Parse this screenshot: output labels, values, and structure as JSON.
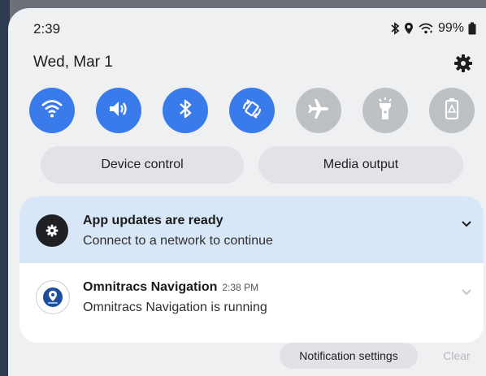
{
  "status_bar": {
    "time": "2:39",
    "battery": "99%",
    "icons": [
      "bluetooth-icon",
      "location-icon",
      "wifi-icon",
      "battery-icon"
    ]
  },
  "header": {
    "date": "Wed, Mar 1",
    "settings_icon": "gear-icon"
  },
  "quick_settings": [
    {
      "name": "wifi",
      "icon": "wifi-icon",
      "state": "on"
    },
    {
      "name": "sound",
      "icon": "volume-icon",
      "state": "on"
    },
    {
      "name": "bluetooth",
      "icon": "bluetooth-icon",
      "state": "on"
    },
    {
      "name": "auto-rotate",
      "icon": "rotate-icon",
      "state": "on"
    },
    {
      "name": "airplane-mode",
      "icon": "airplane-icon",
      "state": "off"
    },
    {
      "name": "flashlight",
      "icon": "flashlight-icon",
      "state": "off"
    },
    {
      "name": "power-saving",
      "icon": "battery-saver-icon",
      "state": "off"
    }
  ],
  "pills": {
    "device_control": "Device control",
    "media_output": "Media output"
  },
  "notifications": [
    {
      "title": "App updates are ready",
      "text": "Connect to a network to continue",
      "icon": "gear-icon"
    },
    {
      "title": "Omnitracs Navigation",
      "time": "2:38 PM",
      "text": "Omnitracs Navigation is running",
      "icon": "map-pin-icon"
    }
  ],
  "footer": {
    "notification_settings": "Notification settings",
    "clear": "Clear"
  },
  "colors": {
    "tile_on": "#3a7bec",
    "tile_off": "#bdc0c4",
    "highlight_notification": "#d8e7f7"
  }
}
